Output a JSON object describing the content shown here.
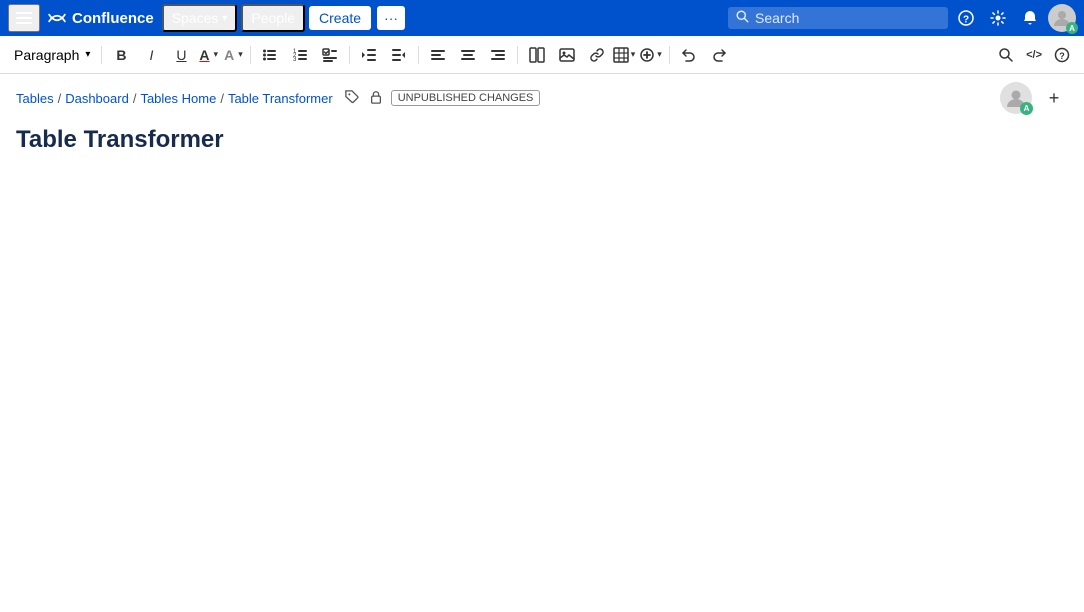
{
  "topnav": {
    "logo_text": "Confluence",
    "spaces_label": "Spaces",
    "people_label": "People",
    "create_label": "Create",
    "create_more_label": "···",
    "search_placeholder": "Search",
    "help_icon": "?",
    "settings_icon": "⚙",
    "notifications_icon": "🔔",
    "avatar_initial": "A"
  },
  "toolbar": {
    "paragraph_label": "Paragraph",
    "bold_label": "B",
    "italic_label": "I",
    "underline_label": "U",
    "text_color_label": "A",
    "text_style_label": "A",
    "bullet_list_label": "≡",
    "numbered_list_label": "≡",
    "task_list_label": "☑",
    "indent_label": "⇥",
    "outdent_label": "⇤",
    "align_left_label": "≡",
    "align_center_label": "≡",
    "align_right_label": "≡",
    "table_layout_label": "▦",
    "insert_image_label": "🖼",
    "insert_link_label": "🔗",
    "insert_table_label": "⊞",
    "insert_more_label": "+",
    "undo_label": "↩",
    "redo_label": "↪",
    "search_icon": "🔍",
    "code_icon": "</>",
    "help_icon": "?"
  },
  "breadcrumb": {
    "items": [
      {
        "label": "Tables",
        "href": "#"
      },
      {
        "label": "Dashboard",
        "href": "#"
      },
      {
        "label": "Tables Home",
        "href": "#"
      },
      {
        "label": "Table Transformer",
        "href": "#"
      }
    ],
    "separator": "/",
    "tag_icon": "🏷",
    "lock_icon": "🔓",
    "unpublished_label": "UNPUBLISHED CHANGES"
  },
  "page": {
    "title": "Table Transformer",
    "avatar_initial": "A"
  }
}
